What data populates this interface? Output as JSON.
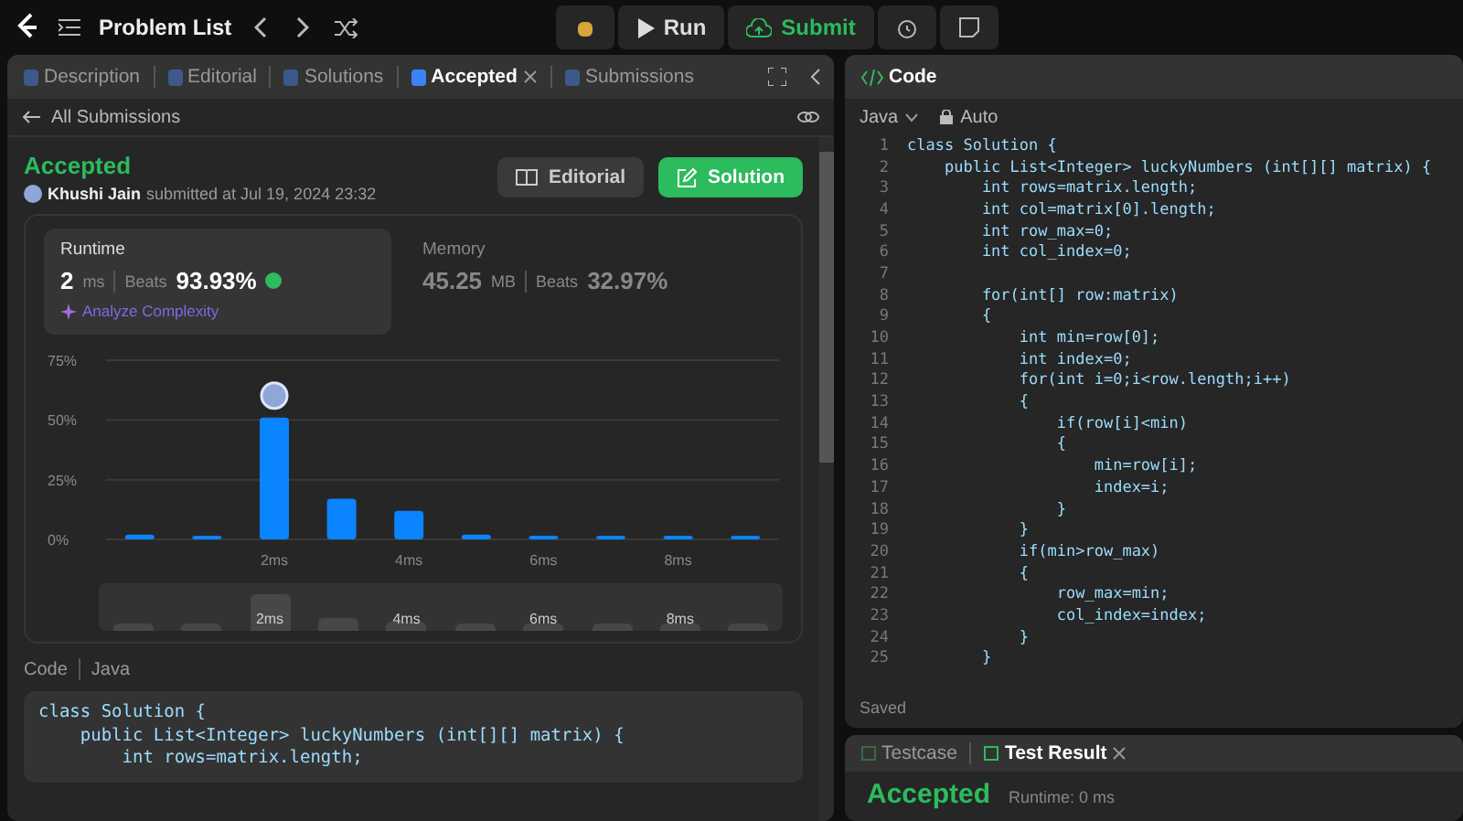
{
  "topbar": {
    "title": "Problem List",
    "run": "Run",
    "submit": "Submit"
  },
  "left_tabs": [
    {
      "label": "Description",
      "selected": false,
      "closable": false
    },
    {
      "label": "Editorial",
      "selected": false,
      "closable": false
    },
    {
      "label": "Solutions",
      "selected": false,
      "closable": false
    },
    {
      "label": "Accepted",
      "selected": true,
      "closable": true
    },
    {
      "label": "Submissions",
      "selected": false,
      "closable": false
    }
  ],
  "back_link": "All Submissions",
  "submission": {
    "status": "Accepted",
    "author": "Khushi Jain",
    "submitted": "submitted at Jul 19, 2024 23:32",
    "buttons": [
      {
        "label": "Editorial",
        "kind": "secondary"
      },
      {
        "label": "Solution",
        "kind": "primary"
      }
    ]
  },
  "stats": [
    {
      "title": "Runtime",
      "value": "2",
      "unit": "ms",
      "beats_label": "Beats",
      "beats": "93.93%",
      "selected": true,
      "link": "Analyze Complexity"
    },
    {
      "title": "Memory",
      "value": "45.25",
      "unit": "MB",
      "beats_label": "Beats",
      "beats": "32.97%",
      "selected": false
    }
  ],
  "chart_data": {
    "type": "bar",
    "categories": [
      null,
      null,
      "2ms",
      null,
      "4ms",
      null,
      "6ms",
      null,
      "8ms",
      null
    ],
    "series": [
      {
        "color": "#0a84ff",
        "values": [
          2,
          1.5,
          51,
          17,
          12,
          2,
          1.5,
          1.5,
          1.5,
          1.5
        ]
      }
    ],
    "ylim": [
      0,
      75
    ],
    "yticks": [
      {
        "value": 0,
        "label": "0%"
      },
      {
        "value": 25,
        "label": "25%"
      },
      {
        "value": 50,
        "label": "50%"
      },
      {
        "value": 75,
        "label": "75%"
      }
    ]
  },
  "overview_labels": [
    "2ms",
    "4ms",
    "6ms",
    "8ms"
  ],
  "code_section": {
    "label": "Code",
    "language": "Java",
    "lines": [
      "class Solution {",
      "    public List<Integer> luckyNumbers (int[][] matrix) {",
      "        int rows=matrix.length;"
    ]
  },
  "editor": {
    "title": "Code",
    "language": "Java",
    "mode": "Auto",
    "status": "Saved",
    "lines": [
      {
        "number": "1",
        "code": "class Solution {"
      },
      {
        "number": "2",
        "code": "    public List<Integer> luckyNumbers (int[][] matrix) {"
      },
      {
        "number": "3",
        "code": "        int rows=matrix.length;"
      },
      {
        "number": "4",
        "code": "        int col=matrix[0].length;"
      },
      {
        "number": "5",
        "code": "        int row_max=0;"
      },
      {
        "number": "6",
        "code": "        int col_index=0;"
      },
      {
        "number": "7"
      },
      {
        "number": "8",
        "code": "        for(int[] row:matrix)"
      },
      {
        "number": "9",
        "code": "        {"
      },
      {
        "number": "10",
        "code": "            int min=row[0];"
      },
      {
        "number": "11",
        "code": "            int index=0;"
      },
      {
        "number": "12",
        "code": "            for(int i=0;i<row.length;i++)"
      },
      {
        "number": "13",
        "code": "            {"
      },
      {
        "number": "14",
        "code": "                if(row[i]<min)"
      },
      {
        "number": "15",
        "code": "                {"
      },
      {
        "number": "16",
        "code": "                    min=row[i];"
      },
      {
        "number": "17",
        "code": "                    index=i;"
      },
      {
        "number": "18",
        "code": "                }"
      },
      {
        "number": "19",
        "code": "            }"
      },
      {
        "number": "20",
        "code": "            if(min>row_max)"
      },
      {
        "number": "21",
        "code": "            {"
      },
      {
        "number": "22",
        "code": "                row_max=min;"
      },
      {
        "number": "23",
        "code": "                col_index=index;"
      },
      {
        "number": "24",
        "code": "            }"
      },
      {
        "number": "25",
        "code": "        }"
      }
    ]
  },
  "bottom_tabs": [
    {
      "label": "Testcase",
      "selected": false
    },
    {
      "label": "Test Result",
      "selected": true
    }
  ],
  "result": {
    "status": "Accepted",
    "runtime": "Runtime: 0 ms"
  }
}
